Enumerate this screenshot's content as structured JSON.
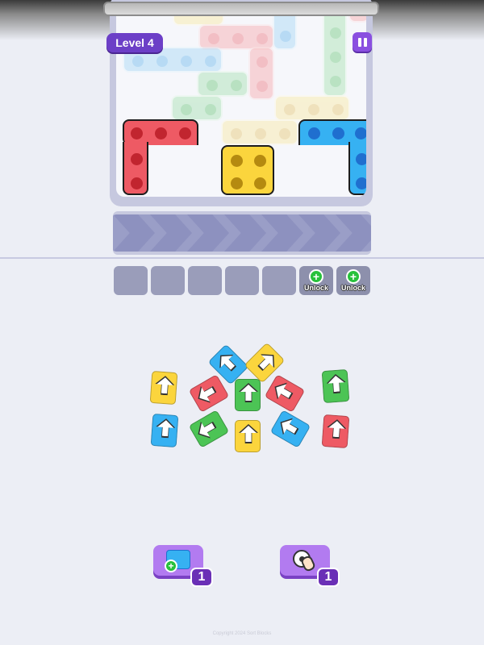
{
  "header": {
    "level_label": "Level 4"
  },
  "colors": {
    "red": "#ee5a64",
    "blue": "#36b1f2",
    "yellow": "#fbd53d",
    "green": "#4cc455",
    "cream": "#f9e8a3",
    "mint": "#a6dfb0",
    "pink": "#f6a9ac",
    "skyblue": "#a6d7f5"
  },
  "board": {
    "active_pieces": [
      {
        "name": "red-l-block",
        "color": "red"
      },
      {
        "name": "yellow-square-block",
        "color": "yellow"
      },
      {
        "name": "blue-l-block",
        "color": "blue"
      }
    ]
  },
  "slots": {
    "empty_count": 5,
    "locked": [
      {
        "label": "Unlock"
      },
      {
        "label": "Unlock"
      }
    ]
  },
  "tiles": [
    {
      "color": "yellow",
      "icon": "arrow-up-icon"
    },
    {
      "color": "blue",
      "icon": "arrow-up-icon"
    },
    {
      "color": "yellow",
      "icon": "arrow-up-icon"
    },
    {
      "color": "green",
      "icon": "arrow-up-icon"
    },
    {
      "color": "red",
      "icon": "arrow-left-icon"
    },
    {
      "color": "green",
      "icon": "arrow-up-icon"
    },
    {
      "color": "red",
      "icon": "arrow-left-icon"
    },
    {
      "color": "blue",
      "icon": "arrow-up-icon"
    },
    {
      "color": "green",
      "icon": "arrow-left-icon"
    },
    {
      "color": "yellow",
      "icon": "arrow-up-icon"
    },
    {
      "color": "blue",
      "icon": "arrow-left-icon"
    },
    {
      "color": "red",
      "icon": "arrow-up-icon"
    }
  ],
  "boosters": [
    {
      "name": "add-block-booster",
      "icon": "add-block-icon",
      "count": "1"
    },
    {
      "name": "magnet-pick-booster",
      "icon": "tap-pick-icon",
      "count": "1"
    }
  ],
  "footer": {
    "text": "Copyright 2024 Sort Blocks"
  }
}
